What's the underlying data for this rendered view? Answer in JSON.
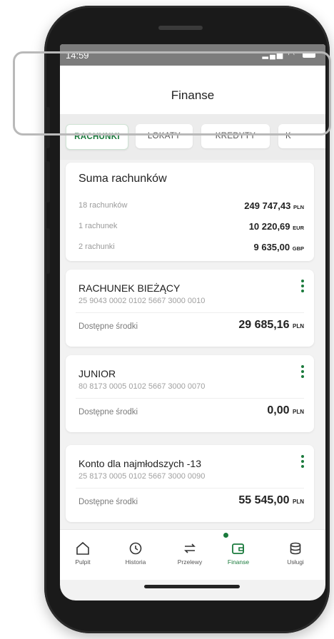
{
  "status_bar": {
    "time": "14:59"
  },
  "header": {
    "title": "Finanse"
  },
  "tabs": [
    {
      "label": "RACHUNKI",
      "active": true
    },
    {
      "label": "LOKATY",
      "active": false
    },
    {
      "label": "KREDYTY",
      "active": false
    },
    {
      "label": "K",
      "active": false
    }
  ],
  "summary": {
    "title": "Suma rachunków",
    "rows": [
      {
        "label": "18 rachunków",
        "amount": "249 747,43",
        "currency": "PLN"
      },
      {
        "label": "1 rachunek",
        "amount": "10 220,69",
        "currency": "EUR"
      },
      {
        "label": "2 rachunki",
        "amount": "9 635,00",
        "currency": "GBP"
      }
    ]
  },
  "accounts": [
    {
      "name": "RACHUNEK BIEŻĄCY",
      "number": "25 9043 0002 0102 5667 3000 0010",
      "balance_label": "Dostępne środki",
      "balance": "29 685,16",
      "currency": "PLN"
    },
    {
      "name": "JUNIOR",
      "number": "80 8173 0005 0102 5667 3000 0070",
      "balance_label": "Dostępne środki",
      "balance": "0,00",
      "currency": "PLN"
    },
    {
      "name": "Konto dla najmłodszych -13",
      "number": "25 8173 0005 0102 5667 3000 0090",
      "balance_label": "Dostępne środki",
      "balance": "55 545,00",
      "currency": "PLN"
    }
  ],
  "nav": [
    {
      "label": "Pulpit",
      "icon": "home-icon"
    },
    {
      "label": "Historia",
      "icon": "history-icon"
    },
    {
      "label": "Przelewy",
      "icon": "transfer-icon"
    },
    {
      "label": "Finanse",
      "icon": "wallet-icon",
      "active": true
    },
    {
      "label": "Usługi",
      "icon": "database-icon"
    }
  ],
  "colors": {
    "accent": "#1a7a3c",
    "background": "#f2f2f2"
  }
}
